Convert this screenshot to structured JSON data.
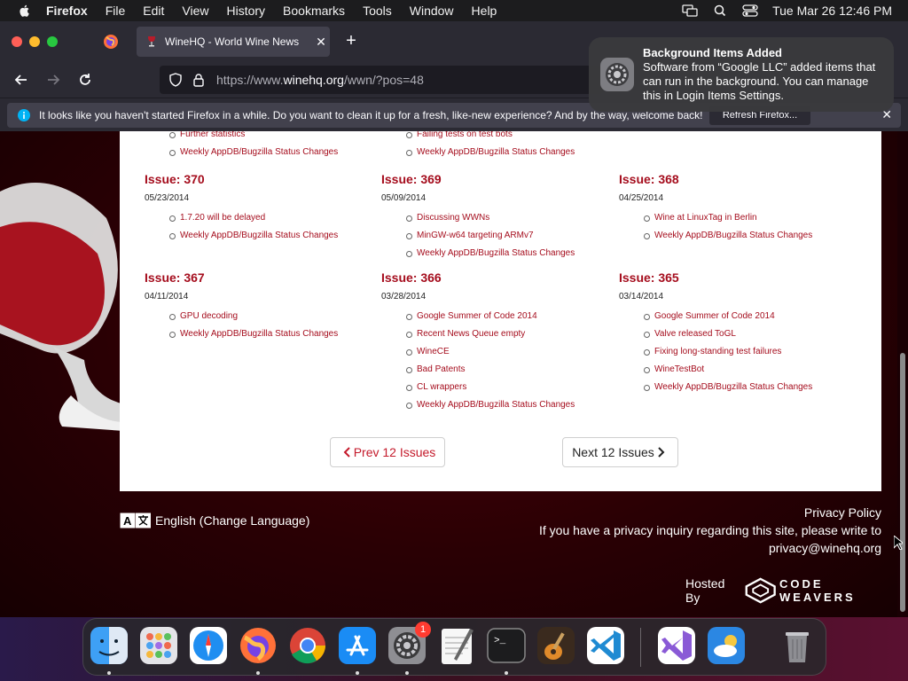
{
  "menubar": {
    "app_name": "Firefox",
    "items": [
      "File",
      "Edit",
      "View",
      "History",
      "Bookmarks",
      "Tools",
      "Window",
      "Help"
    ],
    "clock": "Tue Mar 26  12:46 PM"
  },
  "browser": {
    "tab_title": "WineHQ - World Wine News",
    "url_prefix": "https://www.",
    "url_domain": "winehq.org",
    "url_path": "/wwn/?pos=48",
    "infobar_message": "It looks like you haven't started Firefox in a while. Do you want to clean it up for a fresh, like-new experience? And by the way, welcome back!",
    "refresh_label": "Refresh Firefox..."
  },
  "notification": {
    "title": "Background Items Added",
    "body": "Software from “Google LLC” added items that can run in the background. You can manage this in Login Items Settings."
  },
  "page": {
    "top_partial": [
      {
        "items": [
          "Further statistics",
          "Weekly AppDB/Bugzilla Status Changes"
        ]
      },
      {
        "items": [
          "Failing tests on test bots",
          "Weekly AppDB/Bugzilla Status Changes"
        ]
      }
    ],
    "issues": [
      {
        "title": "Issue: 370",
        "date": "05/23/2014",
        "items": [
          "1.7.20 will be delayed",
          "Weekly AppDB/Bugzilla Status Changes"
        ]
      },
      {
        "title": "Issue: 369",
        "date": "05/09/2014",
        "items": [
          "Discussing WWNs",
          "MinGW-w64 targeting ARMv7",
          "Weekly AppDB/Bugzilla Status Changes"
        ]
      },
      {
        "title": "Issue: 368",
        "date": "04/25/2014",
        "items": [
          "Wine at LinuxTag in Berlin",
          "Weekly AppDB/Bugzilla Status Changes"
        ]
      },
      {
        "title": "Issue: 367",
        "date": "04/11/2014",
        "items": [
          "GPU decoding",
          "Weekly AppDB/Bugzilla Status Changes"
        ]
      },
      {
        "title": "Issue: 366",
        "date": "03/28/2014",
        "items": [
          "Google Summer of Code 2014",
          "Recent News Queue empty",
          "WineCE",
          "Bad Patents",
          "CL wrappers",
          "Weekly AppDB/Bugzilla Status Changes"
        ]
      },
      {
        "title": "Issue: 365",
        "date": "03/14/2014",
        "items": [
          "Google Summer of Code 2014",
          "Valve released ToGL",
          "Fixing long-standing test failures",
          "WineTestBot",
          "Weekly AppDB/Bugzilla Status Changes"
        ]
      }
    ],
    "prev_label": "Prev 12 Issues",
    "next_label": "Next 12 Issues"
  },
  "footer": {
    "language": "English (Change Language)",
    "privacy_policy": "Privacy Policy",
    "privacy_line": "If you have a privacy inquiry regarding this site, please write to",
    "privacy_email": "privacy@winehq.org",
    "hosted_by": "Hosted By",
    "hosted_brand": "CODE WEAVERS"
  },
  "dock": {
    "apps": [
      "finder-icon",
      "launchpad-icon",
      "safari-icon",
      "firefox-icon",
      "chrome-icon",
      "app-store-icon",
      "system-settings-icon",
      "textedit-icon",
      "terminal-icon",
      "garageband-icon",
      "vscode-icon",
      "visual-studio-icon",
      "weather-icon",
      "trash-icon"
    ],
    "settings_badge": "1"
  },
  "colors": {
    "link": "#a50d1d",
    "page_bg": "#2a0004",
    "chrome_bg": "#2b2a33"
  }
}
